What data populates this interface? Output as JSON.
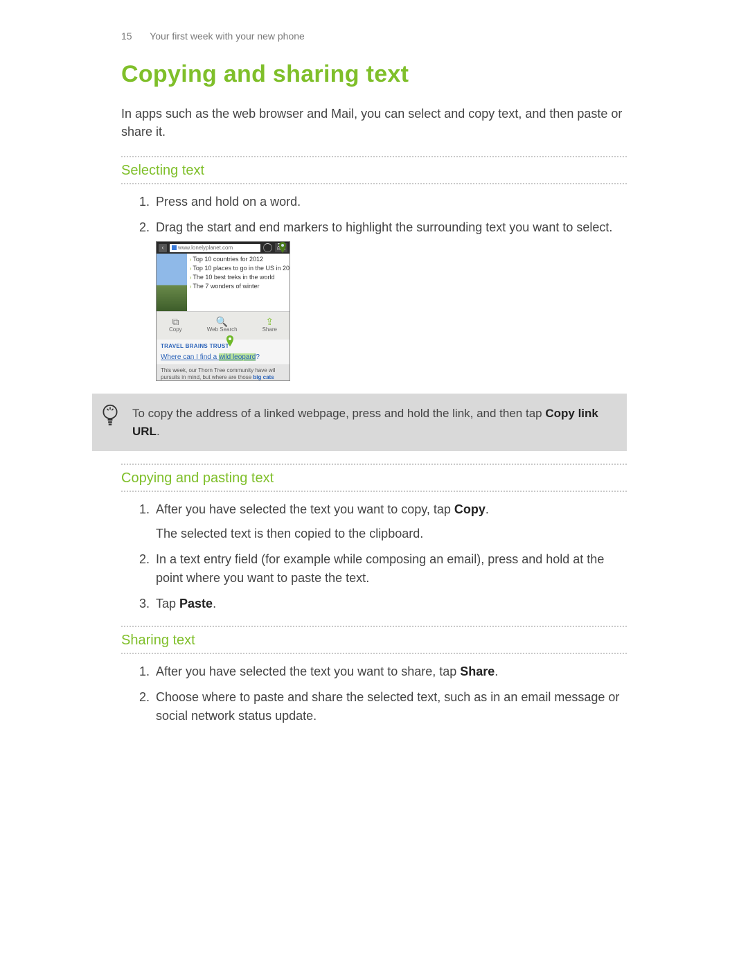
{
  "header": {
    "page_number": "15",
    "chapter": "Your first week with your new phone"
  },
  "title": "Copying and sharing text",
  "intro": "In apps such as the web browser and Mail, you can select and copy text, and then paste or share it.",
  "sections": {
    "selecting": {
      "heading": "Selecting text",
      "step1": "Press and hold on a word.",
      "step2": "Drag the start and end markers to highlight the surrounding text you want to select."
    },
    "copying": {
      "heading": "Copying and pasting text",
      "step1_pre": "After you have selected the text you want to copy, tap ",
      "step1_bold": "Copy",
      "step1_post": ".",
      "step1_sub": "The selected text is then copied to the clipboard.",
      "step2": "In a text entry field (for example while composing an email), press and hold at the point where you want to paste the text.",
      "step3_pre": "Tap ",
      "step3_bold": "Paste",
      "step3_post": "."
    },
    "sharing": {
      "heading": "Sharing text",
      "step1_pre": "After you have selected the text you want to share, tap ",
      "step1_bold": "Share",
      "step1_post": ".",
      "step2": "Choose where to paste and share the selected text, such as in an email message or social network status update."
    }
  },
  "tip": {
    "text_pre": "To copy the address of a linked webpage, press and hold the link, and then tap ",
    "bold": "Copy link URL",
    "text_post": "."
  },
  "screenshot": {
    "url": "www.lonelyplanet.com",
    "menu_label": "Menu",
    "list": {
      "item1": "Top 10 countries for 2012",
      "item2": "Top 10 places to go in the US in 20",
      "item3": "The 10 best treks in the world",
      "item4": "The 7 wonders of winter"
    },
    "actions": {
      "copy": "Copy",
      "web_search": "Web Search",
      "share": "Share"
    },
    "trust_label": "TRAVEL BRAINS TRUST",
    "question_pre": "Where can I find a ",
    "question_hl": "wild leopard",
    "question_post": "?",
    "footer_line1": "This week, our Thorn Tree community have wil",
    "footer_line2_pre": "pursuits in mind, but where are those ",
    "footer_link": "big cats"
  }
}
